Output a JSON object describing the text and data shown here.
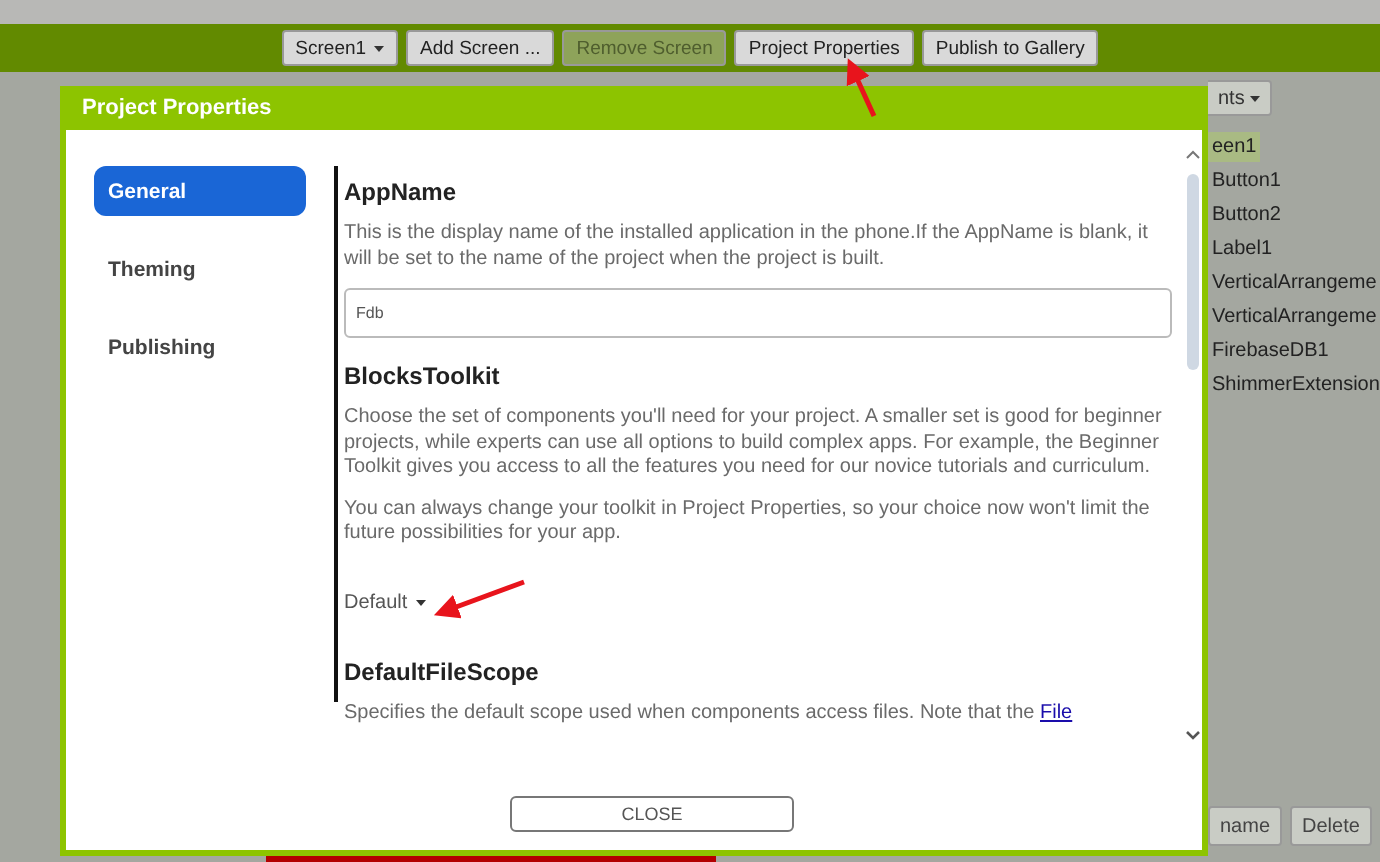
{
  "toolbar": {
    "buttons": [
      {
        "label": "Screen1",
        "kind": "dropdown",
        "disabled": false
      },
      {
        "label": "Add Screen ...",
        "kind": "plain",
        "disabled": false
      },
      {
        "label": "Remove Screen",
        "kind": "plain",
        "disabled": true
      },
      {
        "label": "Project Properties",
        "kind": "plain",
        "disabled": false
      },
      {
        "label": "Publish to Gallery",
        "kind": "plain",
        "disabled": false
      }
    ]
  },
  "components_panel": {
    "header_button": "nts",
    "items": [
      {
        "label": "een1",
        "selected": true
      },
      {
        "label": "Button1",
        "selected": false
      },
      {
        "label": "Button2",
        "selected": false
      },
      {
        "label": "Label1",
        "selected": false
      },
      {
        "label": "VerticalArrangeme",
        "selected": false
      },
      {
        "label": "VerticalArrangeme",
        "selected": false
      },
      {
        "label": "FirebaseDB1",
        "selected": false
      },
      {
        "label": "ShimmerExtension",
        "selected": false
      }
    ],
    "buttons": [
      "name",
      "Delete"
    ]
  },
  "dialog": {
    "title": "Project Properties",
    "nav": [
      {
        "label": "General",
        "selected": true
      },
      {
        "label": "Theming",
        "selected": false
      },
      {
        "label": "Publishing",
        "selected": false
      }
    ],
    "properties": [
      {
        "name": "AppName",
        "kind": "text_field",
        "description": [
          "This is the display name of the installed application in the phone.If the AppName is blank, it will be set to the name of the project when the project is built."
        ],
        "value": "Fdb"
      },
      {
        "name": "BlocksToolkit",
        "kind": "dropdown",
        "description": [
          "Choose the set of components you'll need for your project. A smaller set is good for beginner projects, while experts can use all options to build complex apps. For example, the Beginner Toolkit gives you access to all the features you need for our novice tutorials and curriculum.",
          "You can always change your toolkit in Project Properties, so your choice now won't limit the future possibilities for your app."
        ],
        "value": "Default"
      },
      {
        "name": "DefaultFileScope",
        "kind": "text",
        "description": [
          "Specifies the default scope used when components access files. Note that the"
        ],
        "link": "File"
      }
    ],
    "close_button": "CLOSE"
  }
}
